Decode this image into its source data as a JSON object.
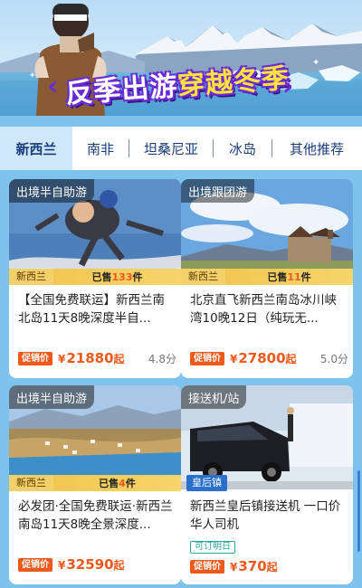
{
  "banner": {
    "title_part1": "反季出游",
    "title_part2": "穿越冬季",
    "bracket_left": "‹",
    "bracket_right": "›",
    "accent_color": "#6b2bd8",
    "highlight_color": "#ffe23b"
  },
  "tabs": [
    {
      "label": "新西兰",
      "active": true
    },
    {
      "label": "南非",
      "active": false
    },
    {
      "label": "坦桑尼亚",
      "active": false
    },
    {
      "label": "冰岛",
      "active": false
    },
    {
      "label": "其他推荐",
      "active": false
    }
  ],
  "cards": [
    {
      "tag": "出境半自助游",
      "destination": "新西兰",
      "sold_prefix": "已售",
      "sold_count": "133",
      "sold_suffix": "件",
      "title": "【全国免费联运】新西兰南北岛11天8晚深度半自...",
      "promo": "促销价",
      "currency": "¥",
      "price": "21880",
      "price_suffix": "起",
      "score": "4.8分"
    },
    {
      "tag": "出境跟团游",
      "destination": "新西兰",
      "sold_prefix": "已售",
      "sold_count": "11",
      "sold_suffix": "件",
      "title": "北京直飞新西兰南岛冰川峡湾10晚12日（纯玩无...",
      "promo": "促销价",
      "currency": "¥",
      "price": "27800",
      "price_suffix": "起",
      "score": "5.0分"
    },
    {
      "tag": "出境半自助游",
      "destination": "新西兰",
      "sold_prefix": "已售",
      "sold_count": "4",
      "sold_suffix": "件",
      "title": "必发团·全国免费联运·新西兰南岛11天8晚全景深度...",
      "promo": "促销价",
      "currency": "¥",
      "price": "32590",
      "price_suffix": "起",
      "score": ""
    },
    {
      "tag": "接送机/站",
      "destination": "皇后镇",
      "title": "新西兰皇后镇接送机 一口价 华人司机",
      "availability": "可订明日",
      "promo": "促销价",
      "currency": "¥",
      "price": "370",
      "price_suffix": "起",
      "score": ""
    }
  ],
  "colors": {
    "page_bg": "#7ec3ee",
    "price": "#ee5a1b",
    "tab_active_bg": "#cfe8fb",
    "tab_text": "#1b3c78"
  }
}
